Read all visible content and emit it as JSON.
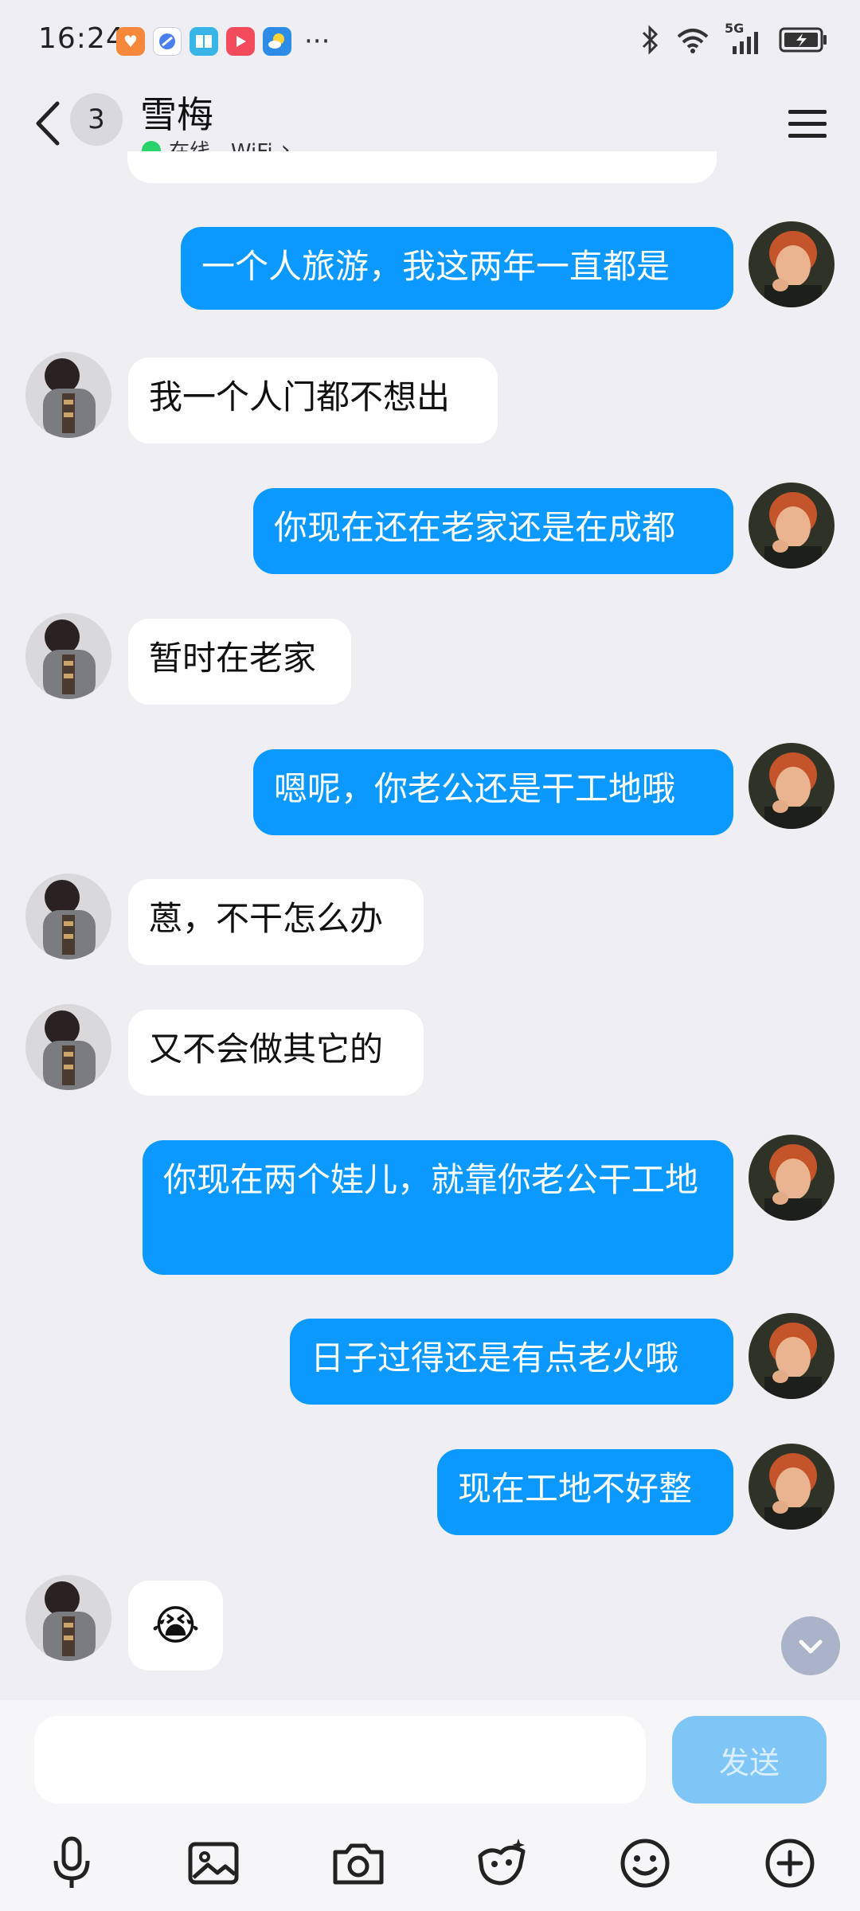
{
  "status_bar": {
    "time": "16:24",
    "more": "···",
    "network": "5G"
  },
  "header": {
    "unread_count": "3",
    "contact_name": "雪梅",
    "online_status": "在线 - WiFi",
    "online_chevron": "›"
  },
  "messages": [
    {
      "side": "out",
      "text": "一个人旅游，我这两年一直都是"
    },
    {
      "side": "in",
      "text": "我一个人门都不想出"
    },
    {
      "side": "out",
      "text": "你现在还在老家还是在成都"
    },
    {
      "side": "in",
      "text": "暂时在老家"
    },
    {
      "side": "out",
      "text": "嗯呢，你老公还是干工地哦"
    },
    {
      "side": "in",
      "text": "蒽，不干怎么办"
    },
    {
      "side": "in",
      "text": "又不会做其它的"
    },
    {
      "side": "out",
      "text": "你现在两个娃儿，就靠你老公干工地"
    },
    {
      "side": "out",
      "text": "日子过得还是有点老火哦"
    },
    {
      "side": "out",
      "text": "现在工地不好整"
    },
    {
      "side": "in",
      "text": "😭",
      "emoji": true
    }
  ],
  "input": {
    "value": "",
    "placeholder": "",
    "send_label": "发送"
  },
  "toolbar": [
    "microphone-icon",
    "image-icon",
    "camera-icon",
    "sticker-icon",
    "emoji-icon",
    "add-icon"
  ],
  "colors": {
    "outgoing_bubble": "#0b99ff",
    "incoming_bubble": "#ffffff",
    "background": "#efeff3",
    "send_disabled": "#7fc6f7",
    "online": "#2ad26a"
  }
}
